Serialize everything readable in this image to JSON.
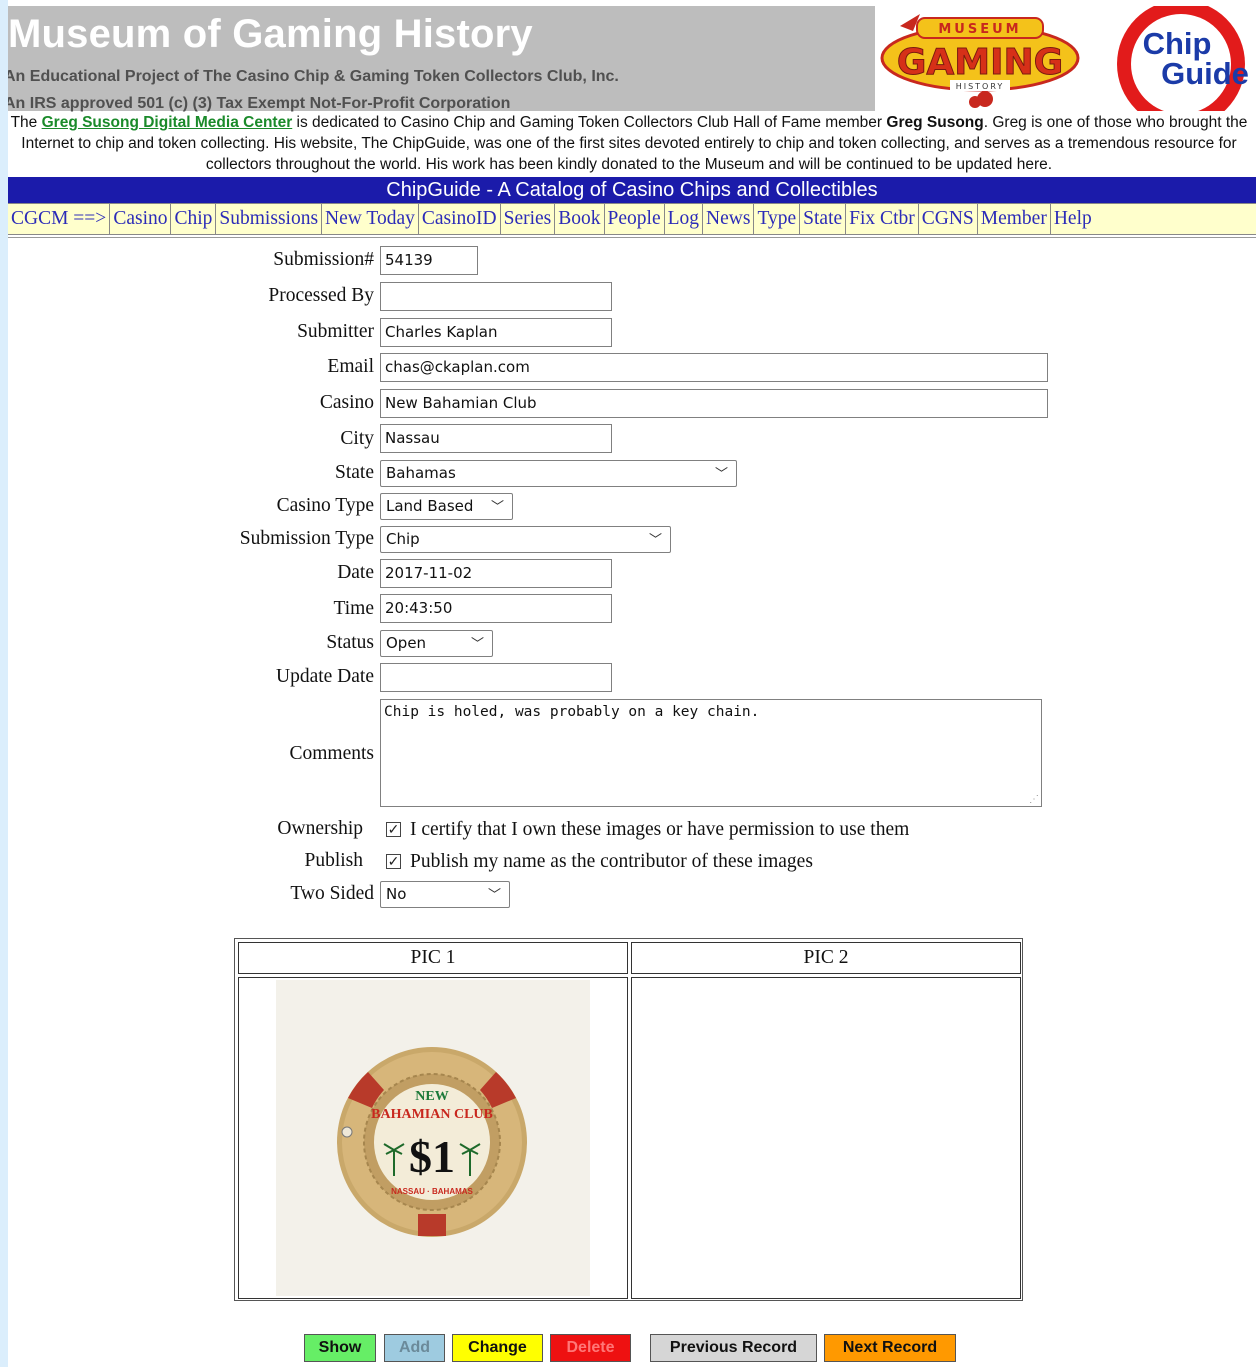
{
  "header": {
    "title": "Museum of Gaming History",
    "subtitle1": "An Educational Project of The Casino Chip & Gaming Token Collectors Club, Inc.",
    "subtitle2": "An IRS approved 501 (c) (3) Tax Exempt Not-For-Profit Corporation",
    "logo_museum_text": "GAMING",
    "logo_museum_top": "MUSEUM",
    "logo_museum_bottom": "HISTORY",
    "logo_chip_line1": "Chip",
    "logo_chip_line2": "Guide"
  },
  "intro": {
    "prefix": "The ",
    "link": "Greg Susong Digital Media Center",
    "middle": " is dedicated to Casino Chip and Gaming Token Collectors Club Hall of Fame member ",
    "name": "Greg Susong",
    "suffix": ". Greg is one of those who brought the Internet to chip and token collecting. His website, The ChipGuide, was one of the first sites devoted entirely to chip and token collecting, and serves as a tremendous resource for collectors throughout the world. His work has been kindly donated to the Museum and will be continued to be updated here."
  },
  "banner": "ChipGuide - A Catalog of Casino Chips and Collectibles",
  "nav": [
    "CGCM ==>",
    "Casino",
    "Chip",
    "Submissions",
    "New Today",
    "CasinoID",
    "Series",
    "Book",
    "People",
    "Log",
    "News",
    "Type",
    "State",
    "Fix Ctbr",
    "CGNS",
    "Member",
    "Help"
  ],
  "form": {
    "submission_label": "Submission#",
    "submission_value": "54139",
    "processed_label": "Processed By",
    "processed_value": "",
    "submitter_label": "Submitter",
    "submitter_value": "Charles Kaplan",
    "email_label": "Email",
    "email_value": "chas@ckaplan.com",
    "casino_label": "Casino",
    "casino_value": "New Bahamian Club",
    "city_label": "City",
    "city_value": "Nassau",
    "state_label": "State",
    "state_value": "Bahamas",
    "casino_type_label": "Casino Type",
    "casino_type_value": "Land Based",
    "submission_type_label": "Submission Type",
    "submission_type_value": "Chip",
    "date_label": "Date",
    "date_value": "2017-11-02",
    "time_label": "Time",
    "time_value": "20:43:50",
    "status_label": "Status",
    "status_value": "Open",
    "update_date_label": "Update Date",
    "update_date_value": "",
    "comments_label": "Comments",
    "comments_value": "Chip is holed, was probably on a key chain.",
    "ownership_label": "Ownership",
    "ownership_text": "I certify that I own these images or have permission to use them",
    "ownership_checked": true,
    "publish_label": "Publish",
    "publish_text": "Publish my name as the contributor of these images",
    "publish_checked": true,
    "two_sided_label": "Two Sided",
    "two_sided_value": "No"
  },
  "pictures": {
    "pic1_header": "PIC 1",
    "pic2_header": "PIC 2",
    "chip_top": "NEW",
    "chip_name": "BAHAMIAN CLUB",
    "chip_value": "$1",
    "chip_bottom": "NASSAU · BAHAMAS"
  },
  "buttons": {
    "show": "Show",
    "add": "Add",
    "change": "Change",
    "delete": "Delete",
    "previous": "Previous Record",
    "next": "Next Record"
  },
  "colors": {
    "banner_blue": "#1b1baa",
    "nav_bg": "#ffffcc",
    "show": "#66ee66",
    "add": "#9ecbe0",
    "change": "#ffff00",
    "delete": "#ee1111",
    "previous": "#d6d6d6",
    "next": "#ff9900"
  }
}
